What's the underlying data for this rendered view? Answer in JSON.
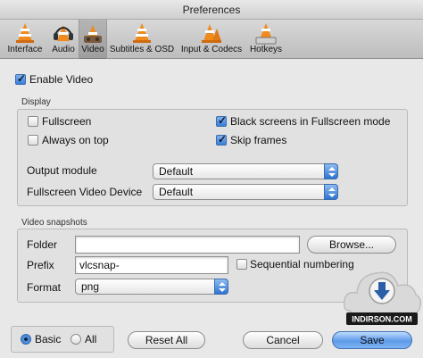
{
  "window": {
    "title": "Preferences"
  },
  "toolbar": {
    "items": [
      {
        "label": "Interface",
        "icon": "cone-interface-icon"
      },
      {
        "label": "Audio",
        "icon": "cone-headphones-icon"
      },
      {
        "label": "Video",
        "icon": "cone-video-icon",
        "selected": true
      },
      {
        "label": "Subtitles & OSD",
        "icon": "cone-subtitles-icon"
      },
      {
        "label": "Input & Codecs",
        "icon": "cone-input-icon"
      },
      {
        "label": "Hotkeys",
        "icon": "cone-hotkeys-icon"
      }
    ]
  },
  "video": {
    "enable_label": "Enable Video",
    "enable_checked": true
  },
  "display": {
    "title": "Display",
    "fullscreen_label": "Fullscreen",
    "fullscreen_checked": false,
    "always_on_top_label": "Always on top",
    "always_on_top_checked": false,
    "black_screens_label": "Black screens in Fullscreen mode",
    "black_screens_checked": true,
    "skip_frames_label": "Skip frames",
    "skip_frames_checked": true,
    "output_module_label": "Output module",
    "output_module_value": "Default",
    "fullscreen_device_label": "Fullscreen Video Device",
    "fullscreen_device_value": "Default"
  },
  "snapshots": {
    "title": "Video snapshots",
    "folder_label": "Folder",
    "folder_value": "",
    "browse_label": "Browse...",
    "prefix_label": "Prefix",
    "prefix_value": "vlcsnap-",
    "sequential_label": "Sequential numbering",
    "sequential_checked": false,
    "format_label": "Format",
    "format_value": "png"
  },
  "footer": {
    "basic_label": "Basic",
    "all_label": "All",
    "mode": "Basic",
    "reset_label": "Reset All",
    "cancel_label": "Cancel",
    "save_label": "Save"
  },
  "watermark": {
    "text": "INDIRSON.COM"
  },
  "colors": {
    "accent": "#3b7fd8",
    "window_bg": "#e8e8e8",
    "cone_orange": "#f08a1c"
  }
}
